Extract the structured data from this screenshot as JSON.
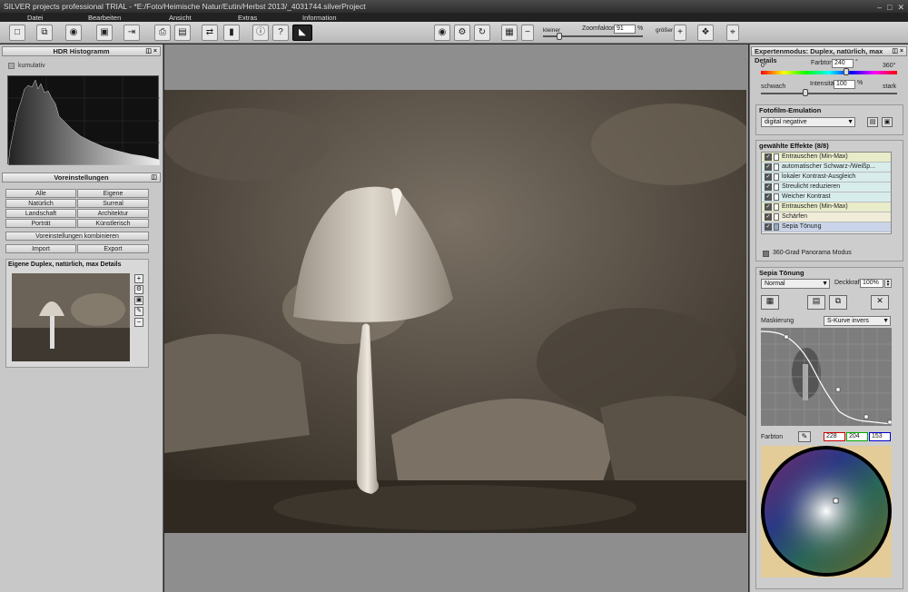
{
  "window": {
    "title": "SILVER projects professional TRIAL - *E:/Foto/Heimische Natur/Eutin/Herbst 2013/_4031744.silverProject"
  },
  "menu": {
    "datei": "Datei",
    "bearbeiten": "Bearbeiten",
    "ansicht": "Ansicht",
    "extras": "Extras",
    "information": "Information"
  },
  "zoom": {
    "kleiner": "kleiner",
    "label": "Zoomfaktor",
    "value": "91",
    "unit": "%",
    "groesser": "größer"
  },
  "left": {
    "histogram_title": "HDR Histogramm",
    "kumulativ": "kumulativ",
    "presets_title": "Voreinstellungen",
    "presets": [
      "Alle",
      "Eigene",
      "Natürlich",
      "Surreal",
      "Landschaft",
      "Architektur",
      "Porträt",
      "Künstlerisch"
    ],
    "kombinieren": "Voreinstellungen kombinieren",
    "import": "Import",
    "export": "Export",
    "preset_name": "Eigene Duplex, natürlich, max Details"
  },
  "right": {
    "title": "Expertenmodus: Duplex, natürlich, max Details",
    "farbton_label": "Farbton",
    "farbton_value": "240",
    "farbton_unit": "°",
    "deg_min": "0°",
    "deg_max": "360°",
    "schwach": "schwach",
    "intensitaet_label": "Intensität",
    "intensitaet_value": "100",
    "intensitaet_unit": "%",
    "stark": "stark",
    "film_title": "Fotofilm-Emulation",
    "film_value": "digital negative",
    "effects_title": "gewählte Effekte (8/8)",
    "effects": [
      "Entrauschen (Min-Max)",
      "automatischer Schwarz-/Weißp...",
      "lokaler Kontrast-Ausgleich",
      "Streulicht reduzieren",
      "Weicher Kontrast",
      "Entrauschen (Min-Max)",
      "Schärfen",
      "Sepia Tönung"
    ],
    "panorama": "360-Grad Panorama Modus",
    "sepia_title": "Sepia Tönung",
    "mode": "Normal",
    "deckkraft_label": "Deckkraft",
    "deckkraft_value": "100%",
    "maskierung": "Maskierung",
    "mask_value": "S-Kurve invers",
    "farbton2": "Farbton",
    "r": "228",
    "g": "204",
    "b": "153"
  },
  "colors": {
    "sepia": "#e4cc99",
    "accent": "#6e62a8"
  }
}
